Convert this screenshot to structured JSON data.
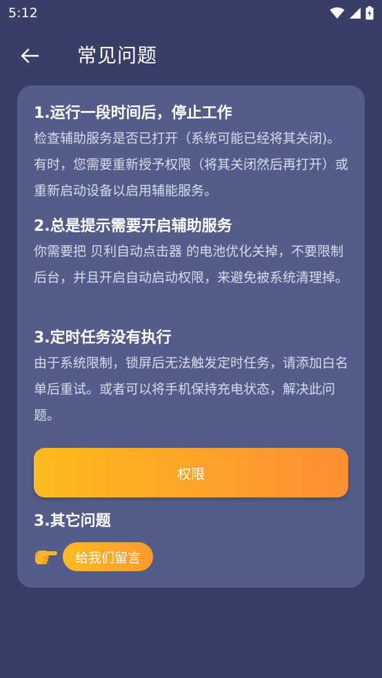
{
  "status_bar": {
    "time": "5:12",
    "icons": [
      "wifi-icon",
      "signal-icon",
      "battery-charging-icon"
    ]
  },
  "app_bar": {
    "back_icon": "arrow-left-icon",
    "title": "常见问题"
  },
  "faq": [
    {
      "question": "1.运行一段时间后，停止工作",
      "answer": "检查辅助服务是否已打开（系统可能已经将其关闭)。有时，您需要重新授予权限（将其关闭然后再打开）或重新启动设备以启用辅能服务。"
    },
    {
      "question": "2.总是提示需要开启辅助服务",
      "answer": "你需要把 贝利自动点击器 的电池优化关掉，不要限制后台，并且开启自动启动权限，来避免被系统清理掉。"
    },
    {
      "question": "3.定时任务没有执行",
      "answer": "由于系统限制，锁屏后无法触发定时任务，请添加白名单后重试。或者可以将手机保持充电状态，解决此问题。"
    }
  ],
  "permission_button": {
    "label": "权限"
  },
  "other": {
    "title": "3.其它问题",
    "icon": "pointing-hand-icon",
    "message_button": "给我们留言"
  },
  "colors": {
    "background": "#393e66",
    "card": "#545c8a",
    "accent_start": "#fdbb1e",
    "accent_end": "#fd8e34"
  }
}
